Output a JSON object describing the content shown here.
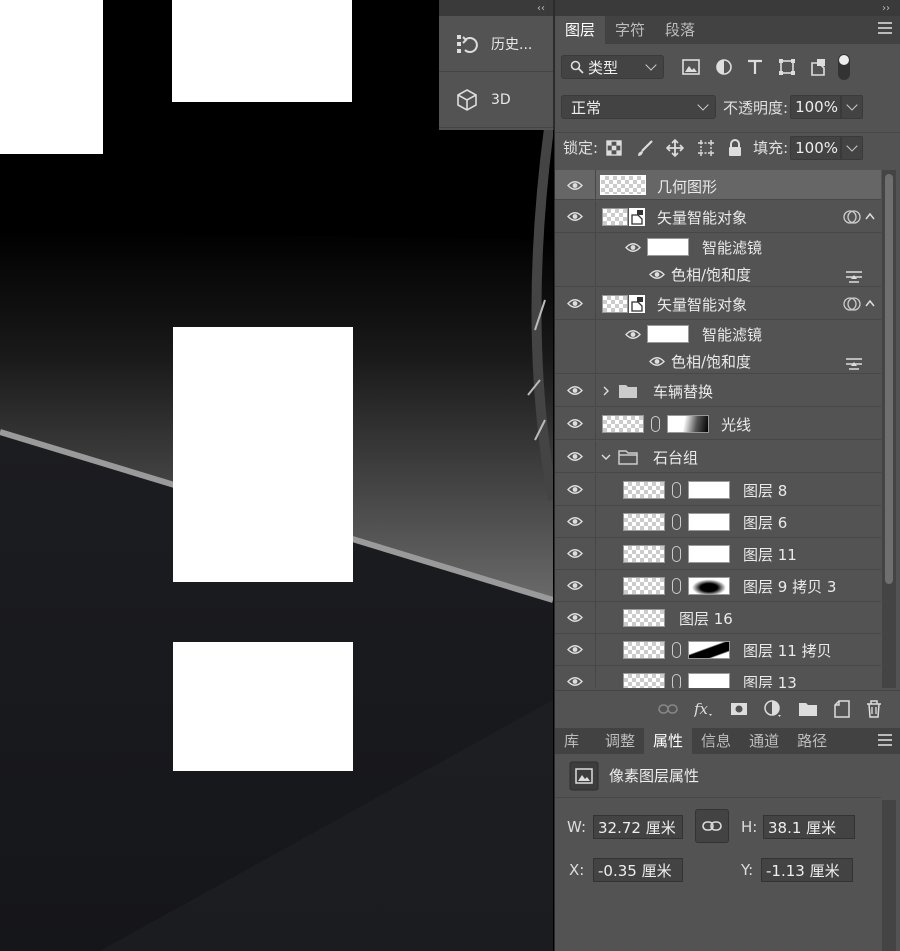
{
  "mini_panel": {
    "collapse_glyph": "‹‹",
    "items": [
      {
        "icon": "history-icon",
        "label": "历史..."
      },
      {
        "icon": "3d-cube-icon",
        "label": "3D"
      }
    ]
  },
  "panel": {
    "collapse_glyph": "››",
    "tabs": [
      {
        "label": "图层",
        "active": true
      },
      {
        "label": "字符",
        "active": false
      },
      {
        "label": "段落",
        "active": false
      }
    ],
    "filter": {
      "kind_label": "类型"
    },
    "blend_mode": "正常",
    "opacity_label": "不透明度:",
    "opacity_value": "100%",
    "lock_label": "锁定:",
    "fill_label": "填充:",
    "fill_value": "100%"
  },
  "layers": [
    {
      "name": "几何图形",
      "type": "pixel",
      "selected": true
    },
    {
      "name": "矢量智能对象",
      "type": "smart"
    },
    {
      "name": "智能滤镜",
      "type": "filter-mask"
    },
    {
      "name": "色相/饱和度",
      "type": "filter"
    },
    {
      "name": "矢量智能对象",
      "type": "smart"
    },
    {
      "name": "智能滤镜",
      "type": "filter-mask"
    },
    {
      "name": "色相/饱和度",
      "type": "filter"
    },
    {
      "name": "车辆替换",
      "type": "group-closed"
    },
    {
      "name": "光线",
      "type": "masked"
    },
    {
      "name": "石台组",
      "type": "group-open"
    },
    {
      "name": "图层 8",
      "type": "masked-child"
    },
    {
      "name": "图层 6",
      "type": "masked-child"
    },
    {
      "name": "图层 11",
      "type": "masked-child"
    },
    {
      "name": "图层 9 拷贝 3",
      "type": "masked-child"
    },
    {
      "name": "图层 16",
      "type": "child"
    },
    {
      "name": "图层 11 拷贝",
      "type": "masked-child"
    },
    {
      "name": "图层 13",
      "type": "masked-child"
    }
  ],
  "footer_icons": [
    "link-icon",
    "fx-icon",
    "mask-icon",
    "adjustment-icon",
    "folder-icon",
    "new-layer-icon",
    "trash-icon"
  ],
  "props": {
    "tabs": [
      {
        "label": "库",
        "active": false
      },
      {
        "label": "调整",
        "active": false
      },
      {
        "label": "属性",
        "active": true
      },
      {
        "label": "信息",
        "active": false
      },
      {
        "label": "通道",
        "active": false
      },
      {
        "label": "路径",
        "active": false
      }
    ],
    "title": "像素图层属性",
    "w_label": "W:",
    "w_value": "32.72 厘米",
    "h_label": "H:",
    "h_value": "38.1 厘米",
    "x_label": "X:",
    "x_value": "-0.35 厘米",
    "y_label": "Y:",
    "y_value": "-1.13 厘米"
  },
  "colors": {
    "panel_bg": "#535353",
    "canvas_bg": "#000000",
    "selected_row": "#666666"
  }
}
